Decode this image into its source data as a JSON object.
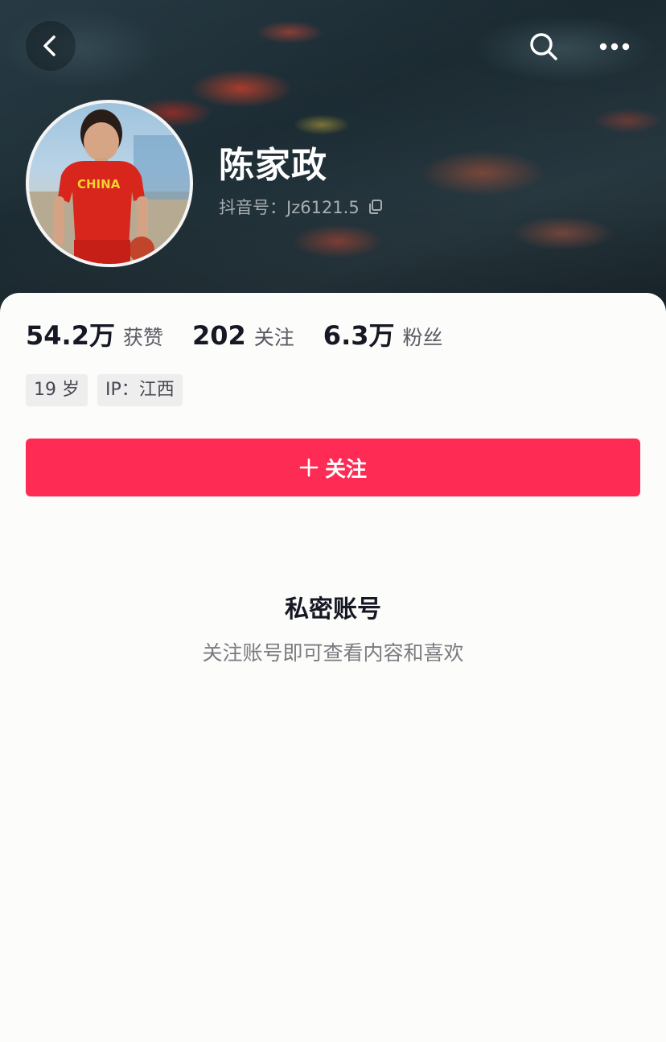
{
  "header": {
    "back_icon": "chevron-left-icon",
    "search_icon": "search-icon",
    "more_icon": "more-horizontal-icon"
  },
  "profile": {
    "avatar_jersey_text": "CHINA",
    "name": "陈家政",
    "account_id": "抖音号：Jz6121.5",
    "copy_icon": "copy-icon"
  },
  "stats": [
    {
      "value": "54.2万",
      "label": "获赞"
    },
    {
      "value": "202",
      "label": "关注"
    },
    {
      "value": "6.3万",
      "label": "粉丝"
    }
  ],
  "tags": [
    "19 岁",
    "IP：江西"
  ],
  "follow_button": {
    "label": "关注",
    "icon": "plus-icon",
    "color": "#fe2c55"
  },
  "private_notice": {
    "title": "私密账号",
    "subtitle": "关注账号即可查看内容和喜欢"
  }
}
